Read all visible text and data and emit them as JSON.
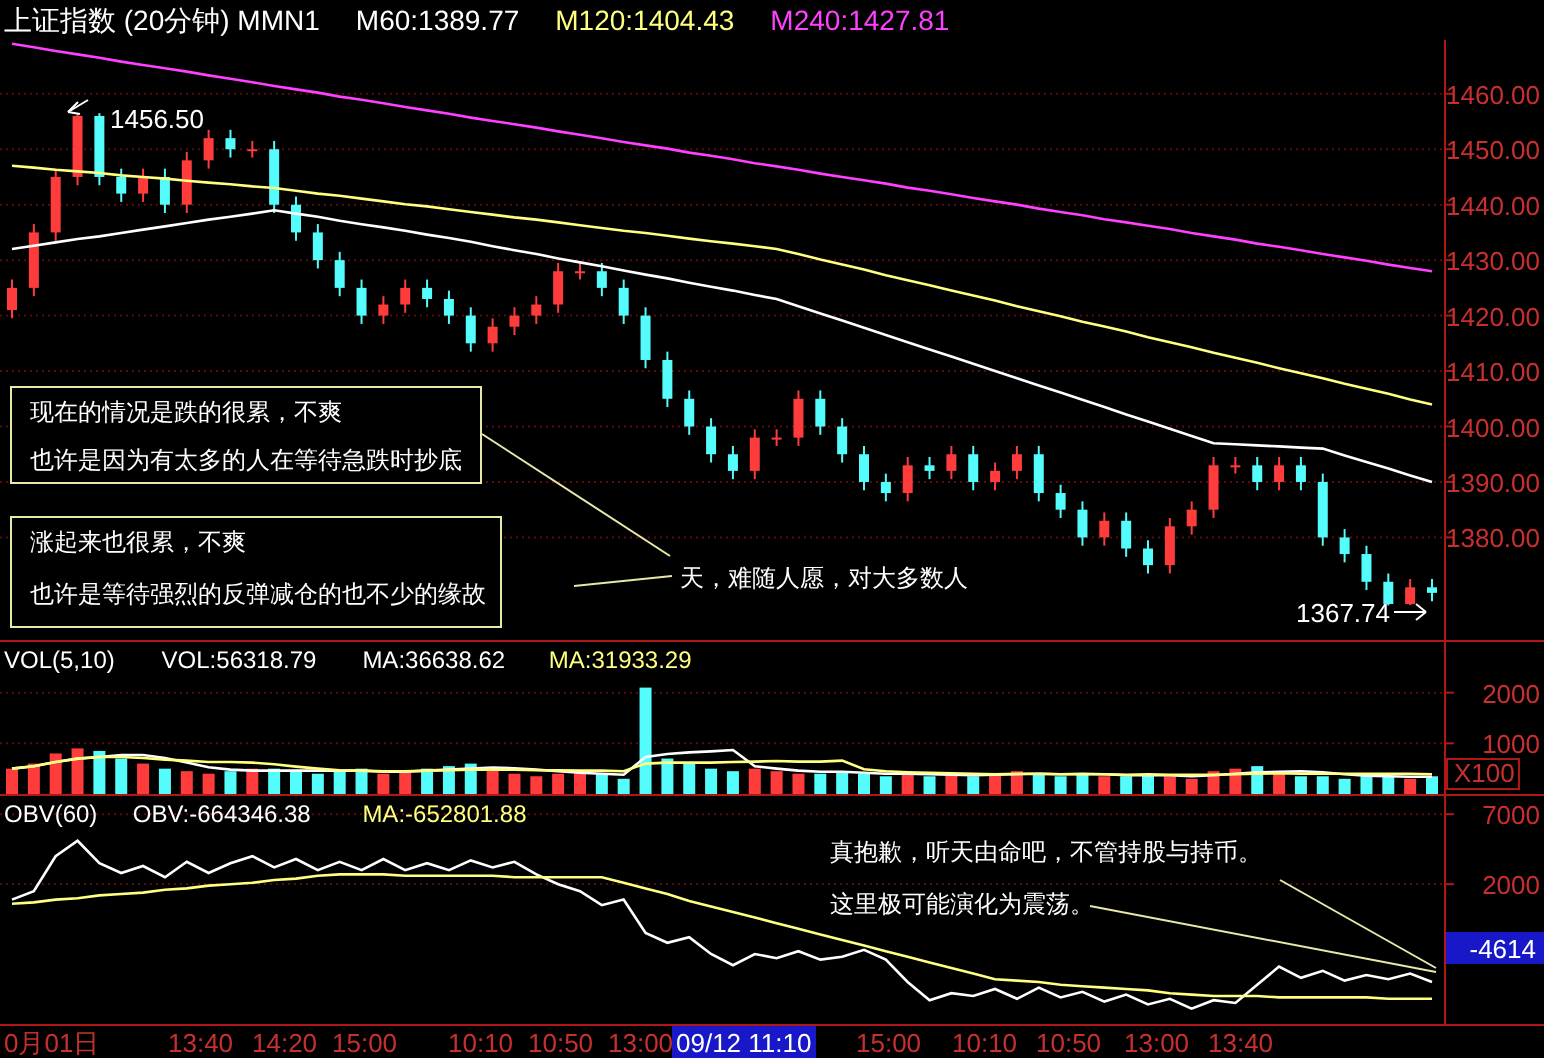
{
  "header": {
    "title": "上证指数 (20分钟) MMN1",
    "indicators": [
      {
        "text": "M60:1389.77",
        "color": "#ffffff"
      },
      {
        "text": "M120:1404.43",
        "color": "#ffff80"
      },
      {
        "text": "M240:1427.81",
        "color": "#ff40ff"
      }
    ]
  },
  "price_panel": {
    "chart_data": {
      "type": "candlestick",
      "grid": true,
      "ohlc": [
        [
          1421,
          1426.5,
          1419.5,
          1425
        ],
        [
          1425,
          1436.5,
          1423.5,
          1435
        ],
        [
          1435,
          1446.5,
          1433.5,
          1445
        ],
        [
          1445,
          1456.5,
          1443.5,
          1456
        ],
        [
          1456,
          1456.5,
          1443.5,
          1445
        ],
        [
          1445,
          1446.5,
          1440.5,
          1442
        ],
        [
          1442,
          1446.5,
          1440.5,
          1445
        ],
        [
          1445,
          1446.5,
          1438.5,
          1440
        ],
        [
          1440,
          1449.5,
          1438.5,
          1448
        ],
        [
          1448,
          1453.5,
          1446.5,
          1452
        ],
        [
          1452,
          1453.5,
          1448.5,
          1450
        ],
        [
          1450,
          1451.5,
          1448.5,
          1450
        ],
        [
          1450,
          1451.5,
          1438.5,
          1440
        ],
        [
          1440,
          1441.5,
          1433.5,
          1435
        ],
        [
          1435,
          1436.5,
          1428.5,
          1430
        ],
        [
          1430,
          1431.5,
          1423.5,
          1425
        ],
        [
          1425,
          1426.5,
          1418.5,
          1420
        ],
        [
          1420,
          1423.5,
          1418.5,
          1422
        ],
        [
          1422,
          1426.5,
          1420.5,
          1425
        ],
        [
          1425,
          1426.5,
          1421.5,
          1423
        ],
        [
          1423,
          1424.5,
          1418.5,
          1420
        ],
        [
          1420,
          1421.5,
          1413.5,
          1415
        ],
        [
          1415,
          1419.5,
          1413.5,
          1418
        ],
        [
          1418,
          1421.5,
          1416.5,
          1420
        ],
        [
          1420,
          1423.5,
          1418.5,
          1422
        ],
        [
          1422,
          1429.5,
          1420.5,
          1428
        ],
        [
          1428,
          1429.5,
          1426.5,
          1428
        ],
        [
          1428,
          1429.5,
          1423.5,
          1425
        ],
        [
          1425,
          1426.5,
          1418.5,
          1420
        ],
        [
          1420,
          1421.5,
          1410.5,
          1412
        ],
        [
          1412,
          1413.5,
          1403.5,
          1405
        ],
        [
          1405,
          1406.5,
          1398.5,
          1400
        ],
        [
          1400,
          1401.5,
          1393.5,
          1395
        ],
        [
          1395,
          1396.5,
          1390.5,
          1392
        ],
        [
          1392,
          1399.5,
          1390.5,
          1398
        ],
        [
          1398,
          1399.5,
          1396.5,
          1398
        ],
        [
          1398,
          1406.5,
          1396.5,
          1405
        ],
        [
          1405,
          1406.5,
          1398.5,
          1400
        ],
        [
          1400,
          1401.5,
          1393.5,
          1395
        ],
        [
          1395,
          1396.5,
          1388.5,
          1390
        ],
        [
          1390,
          1391.5,
          1386.5,
          1388
        ],
        [
          1388,
          1394.5,
          1386.5,
          1393
        ],
        [
          1393,
          1394.5,
          1390.5,
          1392
        ],
        [
          1392,
          1396.5,
          1390.5,
          1395
        ],
        [
          1395,
          1396.5,
          1388.5,
          1390
        ],
        [
          1390,
          1393.5,
          1388.5,
          1392
        ],
        [
          1392,
          1396.5,
          1390.5,
          1395
        ],
        [
          1395,
          1396.5,
          1386.5,
          1388
        ],
        [
          1388,
          1389.5,
          1383.5,
          1385
        ],
        [
          1385,
          1386.5,
          1378.5,
          1380
        ],
        [
          1380,
          1384.5,
          1378.5,
          1383
        ],
        [
          1383,
          1384.5,
          1376.5,
          1378
        ],
        [
          1378,
          1379.5,
          1373.5,
          1375
        ],
        [
          1375,
          1383.5,
          1373.5,
          1382
        ],
        [
          1382,
          1386.5,
          1380.5,
          1385
        ],
        [
          1385,
          1394.5,
          1383.5,
          1393
        ],
        [
          1393,
          1394.5,
          1391.5,
          1393
        ],
        [
          1393,
          1394.5,
          1388.5,
          1390
        ],
        [
          1390,
          1394.5,
          1388.5,
          1393
        ],
        [
          1393,
          1394.5,
          1388.5,
          1390
        ],
        [
          1390,
          1391.5,
          1378.5,
          1380
        ],
        [
          1380,
          1381.5,
          1375.5,
          1377
        ],
        [
          1377,
          1378.5,
          1370.5,
          1372
        ],
        [
          1372,
          1373.5,
          1367.74,
          1368
        ],
        [
          1368,
          1372.5,
          1367.8,
          1371
        ],
        [
          1371,
          1372.5,
          1368.5,
          1370
        ]
      ],
      "ylim": [
        1361.5,
        1469.7
      ],
      "yticks": [
        {
          "value": 1460,
          "label": "1460.00"
        },
        {
          "value": 1450,
          "label": "1450.00"
        },
        {
          "value": 1440,
          "label": "1440.00"
        },
        {
          "value": 1430,
          "label": "1430.00"
        },
        {
          "value": 1420,
          "label": "1420.00"
        },
        {
          "value": 1410,
          "label": "1410.00"
        },
        {
          "value": 1400,
          "label": "1400.00"
        },
        {
          "value": 1390,
          "label": "1390.00"
        },
        {
          "value": 1380,
          "label": "1380.00"
        }
      ],
      "series": [
        {
          "type": "line",
          "color": "#ffffff",
          "values": [
            1432,
            1432.6,
            1433.2,
            1433.8,
            1434.3,
            1434.9,
            1435.5,
            1436.1,
            1436.7,
            1437.3,
            1437.8,
            1438.4,
            1439,
            1438.4,
            1437.8,
            1437.1,
            1436.5,
            1435.9,
            1435.3,
            1434.6,
            1434,
            1433.3,
            1432.5,
            1431.8,
            1431.1,
            1430.3,
            1429.6,
            1428.9,
            1428.1,
            1427.4,
            1426.7,
            1425.9,
            1425.2,
            1424.5,
            1423.7,
            1423,
            1421.7,
            1420.4,
            1419.1,
            1417.8,
            1416.5,
            1415.2,
            1413.9,
            1412.6,
            1411.3,
            1410,
            1408.7,
            1407.4,
            1406.1,
            1404.8,
            1403.5,
            1402.2,
            1400.9,
            1399.6,
            1398.3,
            1397,
            1396.8,
            1396.6,
            1396.4,
            1396.2,
            1396,
            1394.8,
            1393.6,
            1392.4,
            1391.2,
            1390
          ]
        },
        {
          "type": "line",
          "color": "#ffff80",
          "values": [
            1447,
            1446.7,
            1446.3,
            1446,
            1445.7,
            1445.3,
            1445,
            1444.7,
            1444.3,
            1444,
            1443.7,
            1443.3,
            1443,
            1442.5,
            1442,
            1441.6,
            1441.1,
            1440.6,
            1440.1,
            1439.7,
            1439.2,
            1438.7,
            1438.2,
            1437.7,
            1437.3,
            1436.8,
            1436.3,
            1435.8,
            1435.3,
            1434.9,
            1434.4,
            1433.9,
            1433.4,
            1433,
            1432.5,
            1432,
            1431.1,
            1430.1,
            1429.2,
            1428.3,
            1427.3,
            1426.4,
            1425.5,
            1424.5,
            1423.6,
            1422.7,
            1421.7,
            1420.8,
            1419.9,
            1418.9,
            1418,
            1417.1,
            1416.1,
            1415.2,
            1414.3,
            1413.3,
            1412.4,
            1411.5,
            1410.5,
            1409.6,
            1408.7,
            1407.7,
            1406.8,
            1405.9,
            1404.9,
            1404
          ]
        },
        {
          "type": "line",
          "color": "#ff40ff",
          "values": [
            1469,
            1468.4,
            1467.7,
            1467.1,
            1466.5,
            1465.8,
            1465.2,
            1464.6,
            1464,
            1463.3,
            1462.7,
            1462.1,
            1461.4,
            1460.8,
            1460.2,
            1459.5,
            1458.9,
            1458.3,
            1457.6,
            1457,
            1456.4,
            1455.7,
            1455.1,
            1454.5,
            1453.9,
            1453.2,
            1452.6,
            1452,
            1451.3,
            1450.7,
            1450.1,
            1449.4,
            1448.8,
            1448.2,
            1447.5,
            1446.9,
            1446.3,
            1445.6,
            1445,
            1444.4,
            1443.8,
            1443.1,
            1442.5,
            1441.9,
            1441.2,
            1440.6,
            1440,
            1439.3,
            1438.7,
            1438.1,
            1437.4,
            1436.8,
            1436.2,
            1435.6,
            1434.9,
            1434.3,
            1433.7,
            1433,
            1432.4,
            1431.8,
            1431.1,
            1430.5,
            1429.9,
            1429.2,
            1428.6,
            1428
          ]
        }
      ]
    },
    "high_label": "1456.50",
    "low_label": "1367.74",
    "notes": [
      {
        "lines": [
          "现在的情况是跌的很累，不爽",
          "也许是因为有太多的人在等待急跌时抄底"
        ]
      },
      {
        "lines": [
          "涨起来也很累，不爽",
          "也许是等待强烈的反弹减仓的也不少的缘故"
        ]
      }
    ],
    "caption": "天，难随人愿，对大多数人"
  },
  "volume_panel": {
    "indicators": [
      {
        "text": "VOL(5,10)",
        "color": "#ffffff"
      },
      {
        "text": "VOL:56318.79",
        "color": "#ffffff"
      },
      {
        "text": "MA:36638.62",
        "color": "#ffffff"
      },
      {
        "text": "MA:31933.29",
        "color": "#ffff80"
      }
    ],
    "chart_data": {
      "type": "bar",
      "grid": true,
      "ylim": [
        0,
        3000
      ],
      "yticks": [
        1000,
        2000
      ],
      "series": [
        {
          "color": "#ff3c3c",
          "values": [
            500,
            600,
            800,
            900,
            null,
            null,
            600,
            null,
            450,
            400,
            null,
            500,
            null,
            null,
            null,
            null,
            null,
            400,
            450,
            null,
            null,
            null,
            500,
            400,
            350,
            400,
            450,
            null,
            null,
            null,
            null,
            null,
            null,
            null,
            500,
            450,
            400,
            null,
            null,
            null,
            null,
            400,
            null,
            400,
            null,
            400,
            450,
            null,
            null,
            null,
            350,
            null,
            null,
            350,
            300,
            450,
            500,
            null,
            400,
            null,
            null,
            null,
            null,
            null,
            300,
            null
          ]
        },
        {
          "color": "#54fcfc",
          "values": [
            null,
            null,
            null,
            null,
            850,
            700,
            null,
            500,
            null,
            null,
            450,
            null,
            500,
            450,
            400,
            450,
            500,
            null,
            null,
            500,
            550,
            600,
            null,
            null,
            null,
            null,
            null,
            400,
            300,
            2100,
            700,
            600,
            500,
            450,
            null,
            null,
            null,
            400,
            450,
            400,
            350,
            null,
            350,
            null,
            350,
            null,
            null,
            400,
            350,
            400,
            null,
            350,
            400,
            null,
            null,
            null,
            null,
            550,
            null,
            350,
            350,
            300,
            400,
            350,
            null,
            350
          ]
        },
        {
          "type": "line",
          "color": "#ffffff",
          "values": [
            500,
            550,
            630,
            700,
            730,
            770,
            770,
            710,
            620,
            530,
            480,
            460,
            460,
            460,
            460,
            460,
            460,
            440,
            440,
            460,
            480,
            500,
            520,
            510,
            480,
            450,
            420,
            400,
            380,
            730,
            790,
            820,
            840,
            870,
            550,
            500,
            460,
            440,
            440,
            420,
            400,
            400,
            390,
            380,
            370,
            380,
            390,
            400,
            390,
            400,
            390,
            370,
            370,
            370,
            350,
            370,
            400,
            430,
            440,
            450,
            430,
            390,
            360,
            350,
            340,
            340
          ]
        },
        {
          "type": "line",
          "color": "#ffff80",
          "values": [
            500,
            550,
            630,
            700,
            730,
            730,
            710,
            680,
            660,
            630,
            630,
            620,
            590,
            540,
            500,
            470,
            460,
            450,
            450,
            460,
            470,
            480,
            480,
            480,
            470,
            470,
            460,
            460,
            450,
            600,
            620,
            620,
            620,
            630,
            640,
            650,
            640,
            640,
            660,
            490,
            450,
            430,
            420,
            410,
            400,
            390,
            400,
            400,
            390,
            390,
            390,
            380,
            390,
            380,
            380,
            380,
            390,
            400,
            410,
            400,
            400,
            400,
            400,
            400,
            400,
            390
          ]
        }
      ]
    },
    "scale_label": "X100"
  },
  "obv_panel": {
    "indicators": [
      {
        "text": "OBV(60)",
        "color": "#ffffff"
      },
      {
        "text": "OBV:-664346.38",
        "color": "#ffffff"
      },
      {
        "text": "MA:-652801.88",
        "color": "#ffff80"
      }
    ],
    "chart_data": {
      "type": "line",
      "grid": true,
      "ylim": [
        -8000,
        8300
      ],
      "yticks": [
        2000,
        7000
      ],
      "series": [
        {
          "color": "#ffffff",
          "values": [
            900,
            1500,
            4000,
            5100,
            3500,
            2800,
            3300,
            2500,
            3600,
            2800,
            3500,
            4000,
            3200,
            3800,
            3000,
            3600,
            3000,
            3800,
            3000,
            3500,
            3000,
            3700,
            3200,
            3600,
            2700,
            2000,
            1500,
            500,
            900,
            -1500,
            -2200,
            -1800,
            -3000,
            -3800,
            -3000,
            -3300,
            -2800,
            -3400,
            -3200,
            -2700,
            -3400,
            -5000,
            -6300,
            -5800,
            -6000,
            -5500,
            -6200,
            -5400,
            -6100,
            -5700,
            -6400,
            -5900,
            -6600,
            -6200,
            -6900,
            -6300,
            -6500,
            -5200,
            -3900,
            -4700,
            -4200,
            -4900,
            -4500,
            -4800,
            -4400,
            -5000
          ]
        },
        {
          "color": "#ffff80",
          "values": [
            600,
            700,
            900,
            1000,
            1200,
            1300,
            1400,
            1600,
            1700,
            1900,
            2000,
            2100,
            2300,
            2400,
            2600,
            2700,
            2700,
            2700,
            2600,
            2600,
            2600,
            2600,
            2600,
            2500,
            2500,
            2500,
            2500,
            2500,
            2100,
            1700,
            1300,
            800,
            400,
            0,
            -400,
            -800,
            -1200,
            -1600,
            -2000,
            -2400,
            -2800,
            -3200,
            -3600,
            -4000,
            -4400,
            -4800,
            -4900,
            -5000,
            -5200,
            -5300,
            -5400,
            -5500,
            -5600,
            -5800,
            -5900,
            -6000,
            -6000,
            -6000,
            -6100,
            -6100,
            -6100,
            -6100,
            -6100,
            -6200,
            -6200,
            -6200
          ]
        }
      ]
    },
    "current_label": "-4614",
    "notes": [
      "真抱歉，听天由命吧，不管持股与持币。",
      "这里极可能演化为震荡。"
    ]
  },
  "time_axis": {
    "labels": [
      {
        "text": "0月01日",
        "selected": false
      },
      {
        "text": "13:40",
        "selected": false
      },
      {
        "text": "14:20",
        "selected": false
      },
      {
        "text": "15:00",
        "selected": false
      },
      {
        "text": "10:10",
        "selected": false
      },
      {
        "text": "10:50",
        "selected": false
      },
      {
        "text": "13:00",
        "selected": false
      },
      {
        "text": "09/12 11:10",
        "selected": true
      },
      {
        "text": "15:00",
        "selected": false
      },
      {
        "text": "10:10",
        "selected": false
      },
      {
        "text": "10:50",
        "selected": false
      },
      {
        "text": "13:00",
        "selected": false
      },
      {
        "text": "13:40",
        "selected": false
      }
    ]
  }
}
